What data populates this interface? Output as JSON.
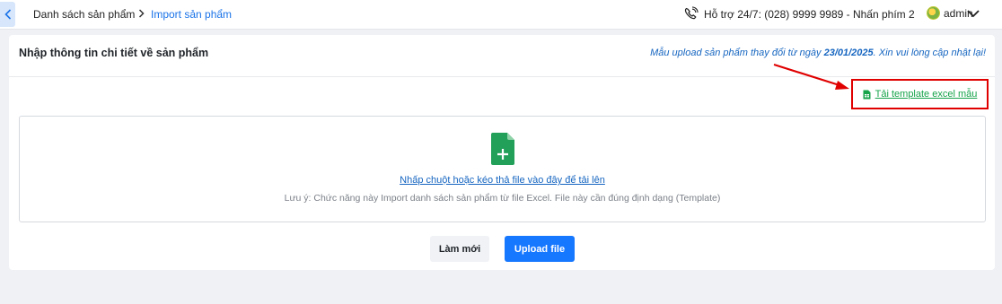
{
  "breadcrumb": {
    "home": "Danh sách sản phẩm",
    "current": "Import sản phẩm"
  },
  "header": {
    "support_text": "Hỗ trợ 24/7: (028) 9999 9989 - Nhấn phím 2",
    "user_name": "admin"
  },
  "card": {
    "title": "Nhập thông tin chi tiết về sản phẩm",
    "notice_prefix": "Mẫu upload sản phẩm thay đổi từ ngày ",
    "notice_date": "23/01/2025",
    "notice_suffix": ". Xin vui lòng cập nhật lại!",
    "template_link": "Tải template excel mẫu"
  },
  "dropzone": {
    "link_text": "Nhấp chuột hoặc kéo thả file vào đây để tải lên",
    "note": "Lưu ý: Chức năng này Import danh sách sản phẩm từ file Excel. File này cần đúng định dạng (Template)"
  },
  "actions": {
    "reset_label": "Làm mới",
    "upload_label": "Upload file"
  },
  "colors": {
    "accent": "#1677ff",
    "link_blue": "#1565c0",
    "excel_green": "#16a34a",
    "highlight_red": "#e00000"
  },
  "icons": {
    "back": "chevron-left-icon",
    "breadcrumb_sep": "chevron-right-icon",
    "support": "phone-icon",
    "user_menu": "chevron-down-icon",
    "template": "excel-file-icon",
    "dropzone": "file-add-icon"
  }
}
